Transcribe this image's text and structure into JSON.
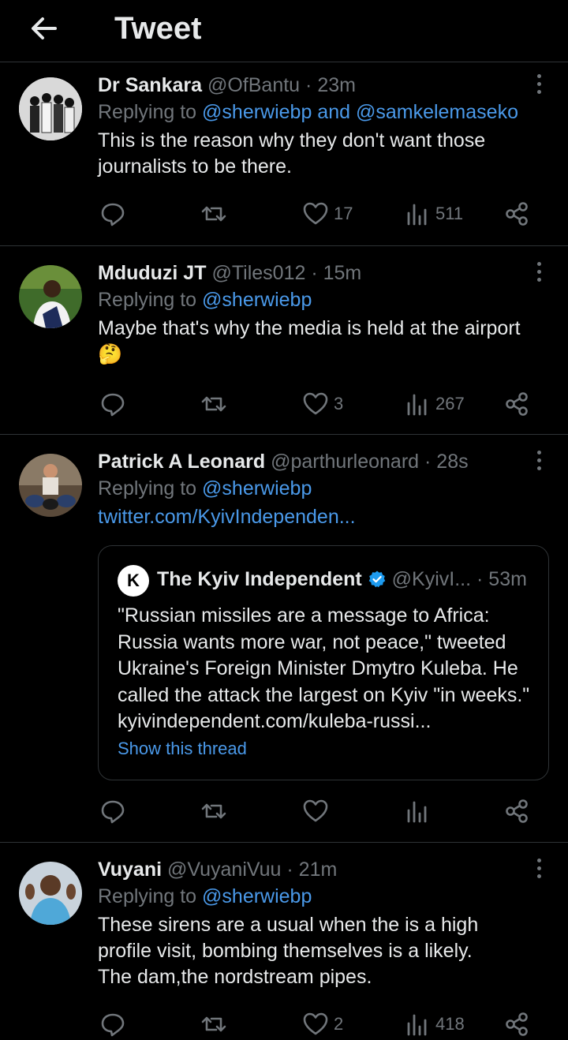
{
  "header": {
    "title": "Tweet"
  },
  "tweets": [
    {
      "name": "Dr Sankara",
      "handle": "@OfBantu",
      "time": "· 23m",
      "replying_prefix": "Replying to",
      "replying_to": "@sherwiebp and @samkelemaseko",
      "text_lines": [
        "This is the reason why they don't want those",
        "journalists to be there."
      ],
      "likes": "17",
      "views": "511"
    },
    {
      "name": "Mduduzi JT",
      "handle": "@Tiles012",
      "time": "· 15m",
      "replying_prefix": "Replying to",
      "replying_to": "@sherwiebp",
      "text_lines": [
        "Maybe that's why the media is held at the airport",
        "🤔"
      ],
      "likes": "3",
      "views": "267"
    },
    {
      "name": "Patrick A Leonard",
      "handle": "@parthurleonard",
      "time": "· 28s",
      "replying_prefix": "Replying to",
      "replying_to": "@sherwiebp",
      "link": "twitter.com/KyivIndependen...",
      "quote": {
        "logo": "K",
        "name": "The Kyiv Independent",
        "handle": "@KyivI...",
        "time": "· 53m",
        "text": "\"Russian missiles are a message to Africa: Russia wants more war, not peace,\" tweeted Ukraine's Foreign Minister Dmytro Kuleba. He called the attack the largest on Kyiv \"in weeks.\" kyivindependent.com/kuleba-russi...",
        "show_thread": "Show this thread"
      }
    },
    {
      "name": "Vuyani",
      "handle": "@VuyaniVuu",
      "time": "· 21m",
      "replying_prefix": "Replying to",
      "replying_to": "@sherwiebp",
      "text_lines": [
        "These sirens are a usual when the is a high",
        "profile visit, bombing themselves is a likely.",
        "The dam,the nordstream pipes."
      ],
      "likes": "2",
      "views": "418"
    }
  ],
  "colors": {
    "background": "#000000",
    "text": "#e7e9ea",
    "muted": "#71767b",
    "link": "#4a99e9",
    "verified": "#1d9bf0",
    "divider": "#2f3336"
  }
}
